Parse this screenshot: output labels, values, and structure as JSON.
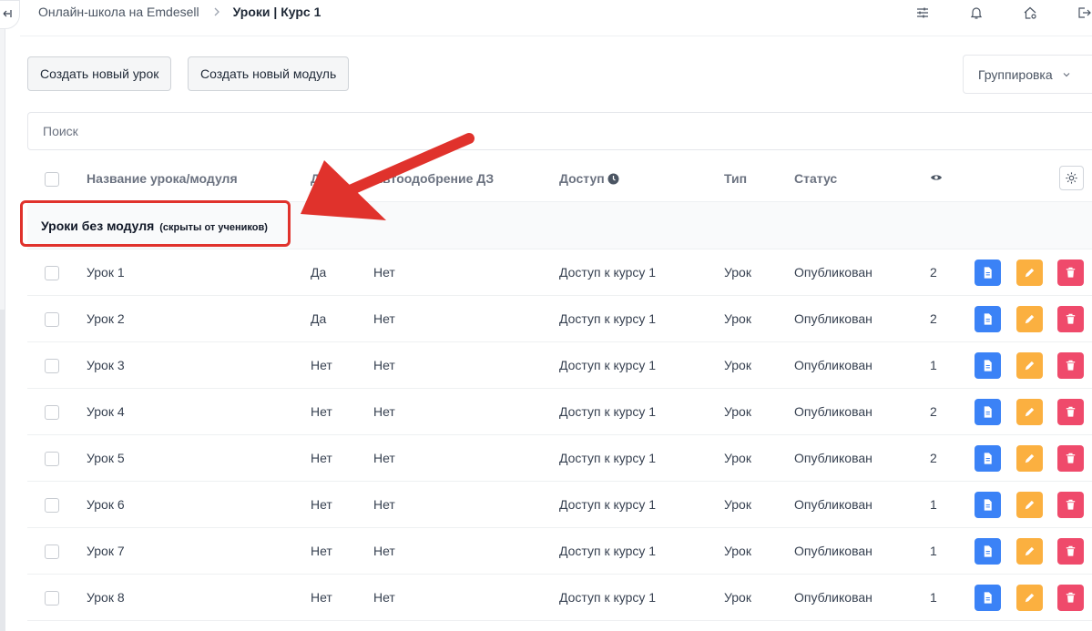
{
  "header": {
    "breadcrumb_root": "Онлайн-школа на Emdesell",
    "breadcrumb_current": "Уроки | Курс 1"
  },
  "toolbar": {
    "new_lesson_label": "Создать новый урок",
    "new_module_label": "Создать новый модуль",
    "grouping_label": "Группировка"
  },
  "search": {
    "placeholder": "Поиск"
  },
  "table": {
    "columns": {
      "name": "Название урока/модуля",
      "homework": "ДЗ",
      "autoapprove": "Автоодобрение ДЗ",
      "access": "Доступ",
      "type": "Тип",
      "status": "Статус"
    },
    "group": {
      "title": "Уроки без модуля",
      "note": "(скрыты от учеников)"
    },
    "rows": [
      {
        "name": "Урок 1",
        "homework": "Да",
        "autoapprove": "Нет",
        "access": "Доступ к курсу 1",
        "type": "Урок",
        "status": "Опубликован",
        "views": "2"
      },
      {
        "name": "Урок 2",
        "homework": "Да",
        "autoapprove": "Нет",
        "access": "Доступ к курсу 1",
        "type": "Урок",
        "status": "Опубликован",
        "views": "2"
      },
      {
        "name": "Урок 3",
        "homework": "Нет",
        "autoapprove": "Нет",
        "access": "Доступ к курсу 1",
        "type": "Урок",
        "status": "Опубликован",
        "views": "1"
      },
      {
        "name": "Урок 4",
        "homework": "Нет",
        "autoapprove": "Нет",
        "access": "Доступ к курсу 1",
        "type": "Урок",
        "status": "Опубликован",
        "views": "2"
      },
      {
        "name": "Урок 5",
        "homework": "Нет",
        "autoapprove": "Нет",
        "access": "Доступ к курсу 1",
        "type": "Урок",
        "status": "Опубликован",
        "views": "2"
      },
      {
        "name": "Урок 6",
        "homework": "Нет",
        "autoapprove": "Нет",
        "access": "Доступ к курсу 1",
        "type": "Урок",
        "status": "Опубликован",
        "views": "1"
      },
      {
        "name": "Урок 7",
        "homework": "Нет",
        "autoapprove": "Нет",
        "access": "Доступ к курсу 1",
        "type": "Урок",
        "status": "Опубликован",
        "views": "1"
      },
      {
        "name": "Урок 8",
        "homework": "Нет",
        "autoapprove": "Нет",
        "access": "Доступ к курсу 1",
        "type": "Урок",
        "status": "Опубликован",
        "views": "1"
      }
    ]
  },
  "colors": {
    "view_button": "#3b82f6",
    "edit_button": "#fbb040",
    "delete_button": "#ef4a6b",
    "annotation": "#e0322c"
  },
  "icons": {
    "header": [
      "sliders-icon",
      "bell-icon",
      "home-settings-icon",
      "logout-icon"
    ],
    "row_actions": [
      "document-icon",
      "pencil-icon",
      "trash-icon"
    ]
  }
}
